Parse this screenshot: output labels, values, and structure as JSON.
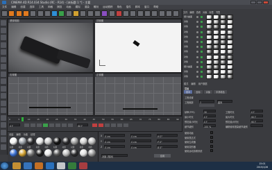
{
  "window": {
    "title": "CINEMA 4D R14.034 Studio (RC - R14) - [未标题 1 *] - 主要"
  },
  "menu": [
    "文件",
    "编辑",
    "创建",
    "选择",
    "工具",
    "网格",
    "捕捉",
    "动画",
    "模拟",
    "渲染",
    "雕刻",
    "运动跟踪",
    "角色",
    "插件",
    "脚本",
    "窗口",
    "帮助"
  ],
  "viewports": {
    "perspective": {
      "label": "透视视图",
      "menu": [
        "查看",
        "摄像机",
        "显示",
        "选项",
        "过滤",
        "面板"
      ]
    },
    "top": {
      "label": "顶视图",
      "menu": [
        "查看",
        "摄像机",
        "显示",
        "选项",
        "过滤",
        "面板"
      ]
    },
    "right": {
      "label": "右视图",
      "menu": [
        "查看",
        "摄像机",
        "显示",
        "选项",
        "过滤",
        "面板"
      ]
    },
    "front": {
      "label": "正视图",
      "menu": [
        "查看",
        "摄像机",
        "显示",
        "选项",
        "过滤",
        "面板"
      ]
    }
  },
  "object_manager": {
    "tabs": [
      "文件",
      "编辑",
      "查看",
      "对象",
      "标签",
      "书签"
    ],
    "rows": [
      "细分曲面",
      "对象",
      "对象",
      "对象",
      "对象",
      "对象",
      "对象",
      "对象",
      "对象",
      "对象",
      "细分曲面",
      "对象",
      "对象"
    ]
  },
  "attributes": {
    "tabs": [
      "模式",
      "编辑",
      "用户数据"
    ],
    "title": "层级",
    "subtabs": [
      "基本",
      "坐标",
      "对象",
      "平滑着色"
    ],
    "section": "工程设置",
    "fps_label": "工程缩放",
    "fps_value": "1",
    "unit": "厘米",
    "rows": [
      {
        "label": "帧率(FPS)",
        "value": "30",
        "label2": "工程时长",
        "value2": "0 F"
      },
      {
        "label": "最小时长",
        "value": "0 F",
        "label2": "最大时长",
        "value2": "90 F"
      },
      {
        "label": "预览最小时长",
        "value": "0 F",
        "label2": "预览最大时长",
        "value2": "90 F"
      },
      {
        "label": "细节级别",
        "value": "100 %",
        "label2": "编辑使用渲染细节级别",
        "value2": ""
      }
    ],
    "checks": [
      "使用动画",
      "使用表达式",
      "使用生成器",
      "使用变形器",
      "使用运动剪辑系统"
    ]
  },
  "timeline": {
    "frames": [
      "0",
      "5",
      "10",
      "15",
      "20",
      "25",
      "30",
      "35",
      "40",
      "45",
      "50",
      "55",
      "60",
      "65",
      "70",
      "75",
      "80",
      "85",
      "90"
    ],
    "current": "0 F",
    "end": "90 F"
  },
  "materials": {
    "tabs": [
      "创建",
      "编辑",
      "功能",
      "纹理"
    ],
    "labels": [
      "材质",
      "材质",
      "材质",
      "材质",
      "材质",
      "材质",
      "材质",
      "材质",
      "材质",
      "材质"
    ]
  },
  "coords": {
    "rows": [
      {
        "axis": "X",
        "pos": "0 cm",
        "size": "0 cm",
        "rot": "H 0°"
      },
      {
        "axis": "Y",
        "pos": "0 cm",
        "size": "0 cm",
        "rot": "P 0°"
      },
      {
        "axis": "Z",
        "pos": "0 cm",
        "size": "0 cm",
        "rot": "B 0°"
      }
    ],
    "mode": "对象 (相对)",
    "apply": "应用"
  },
  "clock": {
    "time": "15:01",
    "date": "2015/1/26"
  },
  "colors": {
    "accent": "#e07a1f",
    "taskbar": "#1d2f45"
  }
}
